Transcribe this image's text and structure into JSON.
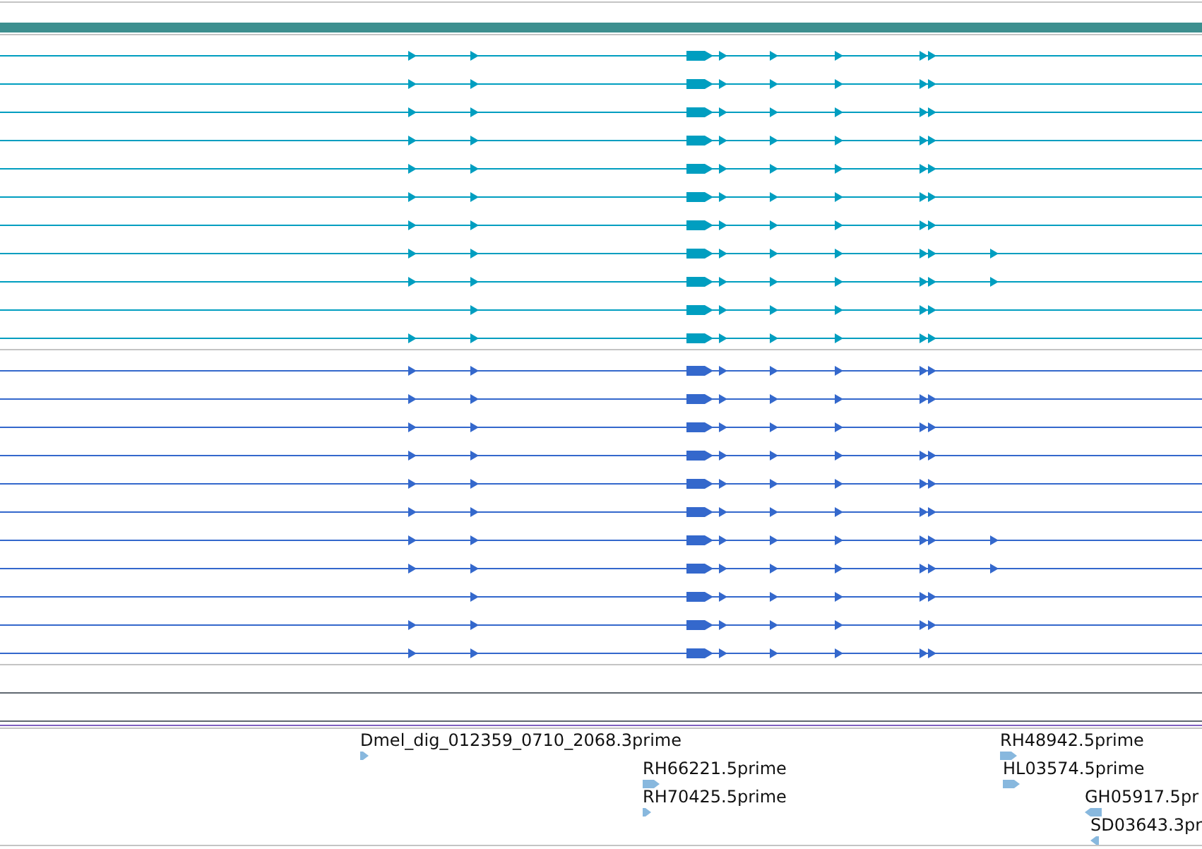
{
  "tracks": [
    {
      "color": "#009ec0",
      "transcripts": [
        {
          "kind": "standard"
        },
        {
          "kind": "standard"
        },
        {
          "kind": "standard"
        },
        {
          "kind": "standard"
        },
        {
          "kind": "standard"
        },
        {
          "kind": "standard"
        },
        {
          "kind": "standard"
        },
        {
          "kind": "extended"
        },
        {
          "kind": "extended"
        },
        {
          "kind": "partial"
        },
        {
          "kind": "standard"
        }
      ]
    },
    {
      "color": "#3468cc",
      "transcripts": [
        {
          "kind": "standard"
        },
        {
          "kind": "standard"
        },
        {
          "kind": "standard"
        },
        {
          "kind": "standard"
        },
        {
          "kind": "standard"
        },
        {
          "kind": "standard"
        },
        {
          "kind": "extended"
        },
        {
          "kind": "extended"
        },
        {
          "kind": "partial"
        },
        {
          "kind": "standard"
        },
        {
          "kind": "standard"
        }
      ]
    }
  ],
  "features": [
    {
      "label": "Dmel_dig_012359_0710_2068.3prime",
      "kind": "forward"
    },
    {
      "label": "RH66221.5prime",
      "kind": "forwardwide"
    },
    {
      "label": "RH70425.5prime",
      "kind": "forward"
    },
    {
      "label": "RH48942.5prime",
      "kind": "forwardwide"
    },
    {
      "label": "HL03574.5prime",
      "kind": "forwardwide"
    },
    {
      "label": "GH05917.5pr",
      "kind": "reversewide"
    },
    {
      "label": "SD03643.3pr",
      "kind": "reverse"
    }
  ]
}
